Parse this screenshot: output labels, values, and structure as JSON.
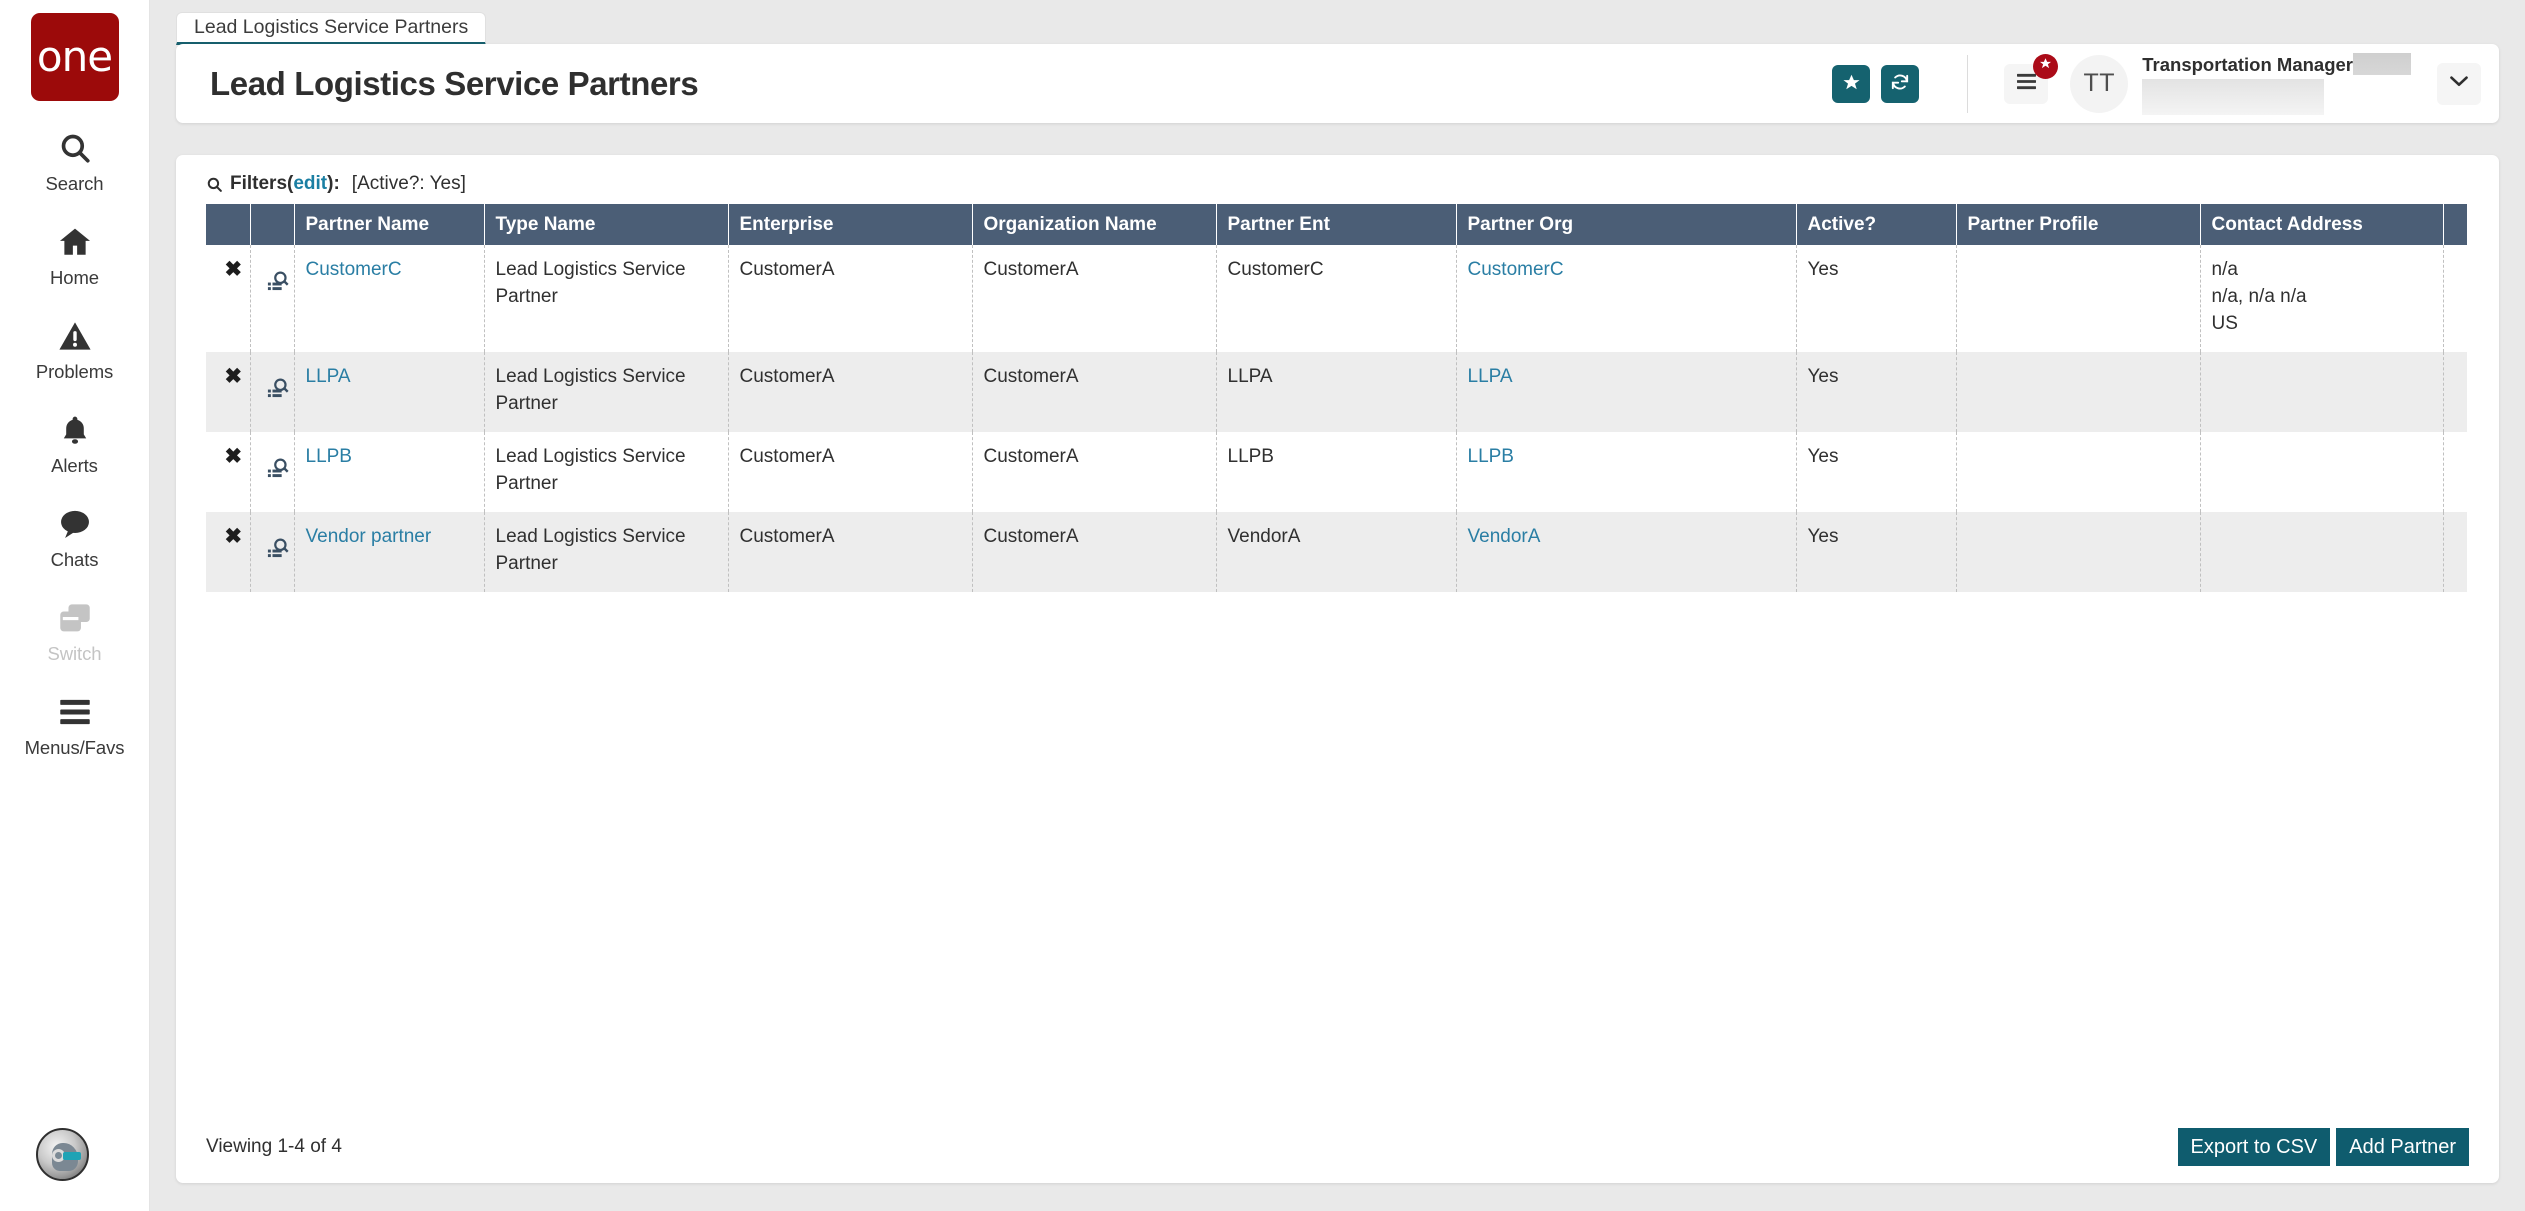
{
  "brand": {
    "logo_text": "one"
  },
  "sidebar": {
    "items": [
      {
        "label": "Search",
        "icon": "search-icon",
        "disabled": false
      },
      {
        "label": "Home",
        "icon": "home-icon",
        "disabled": false
      },
      {
        "label": "Problems",
        "icon": "warning-icon",
        "disabled": false
      },
      {
        "label": "Alerts",
        "icon": "bell-icon",
        "disabled": false
      },
      {
        "label": "Chats",
        "icon": "chat-icon",
        "disabled": false
      },
      {
        "label": "Switch",
        "icon": "switch-icon",
        "disabled": true
      },
      {
        "label": "Menus/Favs",
        "icon": "hamburger-icon",
        "disabled": false
      }
    ],
    "assistant_avatar": "robot-avatar-icon"
  },
  "tab": {
    "label": "Lead Logistics Service Partners"
  },
  "header": {
    "title": "Lead Logistics Service Partners",
    "favorite_icon": "star-icon",
    "refresh_icon": "refresh-icon",
    "menu_icon": "hamburger-icon",
    "menu_badge_icon": "star-icon",
    "avatar_initials": "TT",
    "user_role": "Transportation Manager",
    "caret_icon": "chevron-down-icon",
    "accent_color": "#15626f",
    "badge_color": "#ab0b18"
  },
  "filters": {
    "icon": "search-icon",
    "label": "Filters",
    "edit_label": "edit",
    "colon": "):",
    "open_paren": "(",
    "value": "[Active?: Yes]"
  },
  "table": {
    "columns": [
      "",
      "",
      "Partner Name",
      "Type Name",
      "Enterprise",
      "Organization Name",
      "Partner Ent",
      "Partner Org",
      "Active?",
      "Partner Profile",
      "Contact Address",
      ""
    ],
    "delete_icon": "close-x-icon",
    "view_icon": "view-details-icon",
    "header_bg": "#4b5e76",
    "rows": [
      {
        "partner_name": "CustomerC",
        "type_name": "Lead Logistics Service Partner",
        "enterprise": "CustomerA",
        "organization_name": "CustomerA",
        "partner_ent": "CustomerC",
        "partner_org": "CustomerC",
        "active": "Yes",
        "partner_profile": "",
        "contact_address": "n/a\nn/a, n/a n/a\nUS",
        "extra": ""
      },
      {
        "partner_name": "LLPA",
        "type_name": "Lead Logistics Service Partner",
        "enterprise": "CustomerA",
        "organization_name": "CustomerA",
        "partner_ent": "LLPA",
        "partner_org": "LLPA",
        "active": "Yes",
        "partner_profile": "",
        "contact_address": "",
        "extra": ""
      },
      {
        "partner_name": "LLPB",
        "type_name": "Lead Logistics Service Partner",
        "enterprise": "CustomerA",
        "organization_name": "CustomerA",
        "partner_ent": "LLPB",
        "partner_org": "LLPB",
        "active": "Yes",
        "partner_profile": "",
        "contact_address": "",
        "extra": ""
      },
      {
        "partner_name": "Vendor partner",
        "type_name": "Lead Logistics Service Partner",
        "enterprise": "CustomerA",
        "organization_name": "CustomerA",
        "partner_ent": "VendorA",
        "partner_org": "VendorA",
        "active": "Yes",
        "partner_profile": "",
        "contact_address": "",
        "extra": ""
      }
    ]
  },
  "footer": {
    "viewing": "Viewing 1-4 of 4",
    "export_label": "Export to CSV",
    "add_label": "Add Partner",
    "button_color": "#0f5c6e"
  }
}
